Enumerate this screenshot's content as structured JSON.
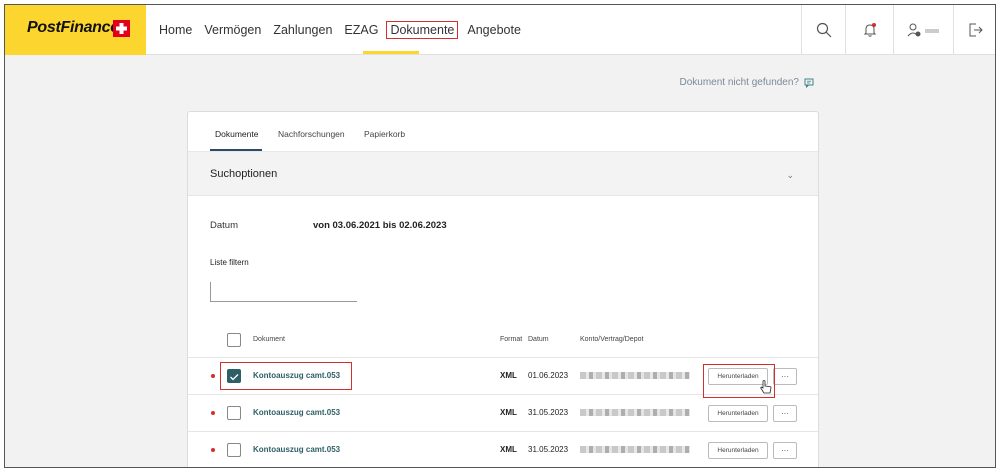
{
  "brand": {
    "name": "PostFinance",
    "color": "#fcd52e",
    "cross_color": "#e2001a"
  },
  "nav": [
    {
      "label": "Home"
    },
    {
      "label": "Vermögen"
    },
    {
      "label": "Zahlungen"
    },
    {
      "label": "EZAG"
    },
    {
      "label": "Dokumente",
      "active": true
    },
    {
      "label": "Angebote"
    }
  ],
  "header_icons": [
    "search-icon",
    "bell-icon",
    "user-icon",
    "logout-icon"
  ],
  "help_link": "Dokument nicht gefunden?",
  "tabs": [
    {
      "label": "Dokumente",
      "active": true
    },
    {
      "label": "Nachforschungen"
    },
    {
      "label": "Papierkorb"
    }
  ],
  "search_options": {
    "title": "Suchoptionen"
  },
  "date": {
    "label": "Datum",
    "value": "von 03.06.2021 bis 02.06.2023"
  },
  "filter": {
    "label": "Liste filtern",
    "value": ""
  },
  "table": {
    "columns": [
      "Dokument",
      "Format",
      "Datum",
      "Konto/Vertrag/Depot"
    ],
    "rows": [
      {
        "document": "Kontoauszug camt.053",
        "format": "XML",
        "date": "01.06.2023",
        "checked": true,
        "download": "Herunterladen",
        "more": "···"
      },
      {
        "document": "Kontoauszug camt.053",
        "format": "XML",
        "date": "31.05.2023",
        "checked": false,
        "download": "Herunterladen",
        "more": "···"
      },
      {
        "document": "Kontoauszug camt.053",
        "format": "XML",
        "date": "31.05.2023",
        "checked": false,
        "download": "Herunterladen",
        "more": "···"
      }
    ]
  }
}
